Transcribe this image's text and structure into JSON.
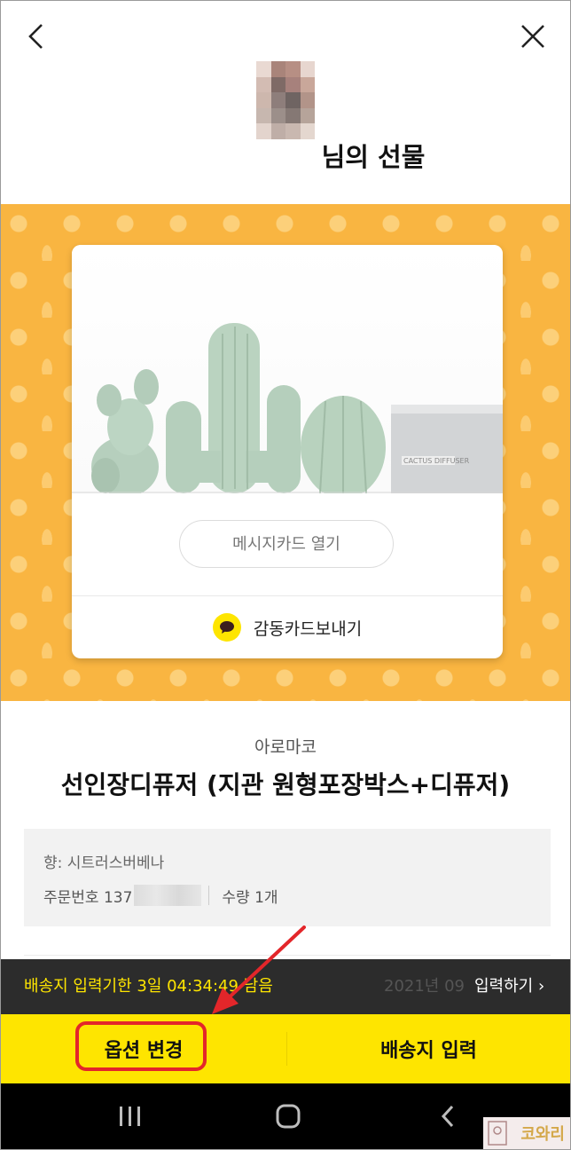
{
  "header": {
    "back_icon": "chevron-left-icon",
    "close_icon": "close-icon",
    "title": "님의 선물"
  },
  "card": {
    "message_card_button": "메시지카드 열기",
    "thank_card_button": "감동카드보내기",
    "thank_card_icon": "kakaotalk-icon"
  },
  "product": {
    "brand": "아로마코",
    "name": "선인장디퓨저 (지관 원형포장박스+디퓨저)",
    "option": "향: 시트러스버베나",
    "order_label": "주문번호 137",
    "quantity": "수량 1개",
    "image_label": "CACTUS DIFFUSER"
  },
  "deadline": {
    "text": "배송지 입력기한 3일 04:34:49 남음",
    "date": "2021년 09",
    "enter_link": "입력하기 ›"
  },
  "actions": {
    "option_change": "옵션 변경",
    "enter_address": "배송지 입력"
  },
  "nav": {
    "recent_icon": "recent-apps-icon",
    "home_icon": "home-icon",
    "back_icon": "nav-back-icon"
  },
  "watermark": {
    "text": "코와리"
  },
  "colors": {
    "banner": "#f9b541",
    "action_bar": "#fee500",
    "deadline_text": "#fee500",
    "highlight": "#e3262a",
    "cactus": "#b8d3bf"
  }
}
